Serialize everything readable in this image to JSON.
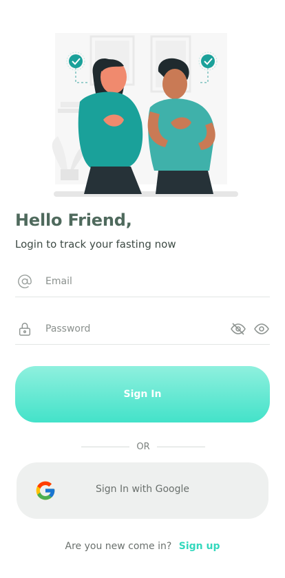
{
  "greeting": "Hello Friend,",
  "subtitle": "Login to track your fasting now",
  "email": {
    "placeholder": "Email",
    "value": ""
  },
  "password": {
    "placeholder": "Password",
    "value": ""
  },
  "signin_label": "Sign In",
  "divider_text": "OR",
  "google_label": "Sign In with Google",
  "footer": {
    "question": "Are you new come in?",
    "link": "Sign up"
  },
  "colors": {
    "accent": "#3fe0c6",
    "heading": "#4f6a5d",
    "link": "#33d8bd",
    "google_bg": "#eef0ef"
  },
  "icons": [
    "at-sign-icon",
    "lock-icon",
    "eye-off-icon",
    "eye-icon",
    "google-icon",
    "check-badge-icon"
  ]
}
